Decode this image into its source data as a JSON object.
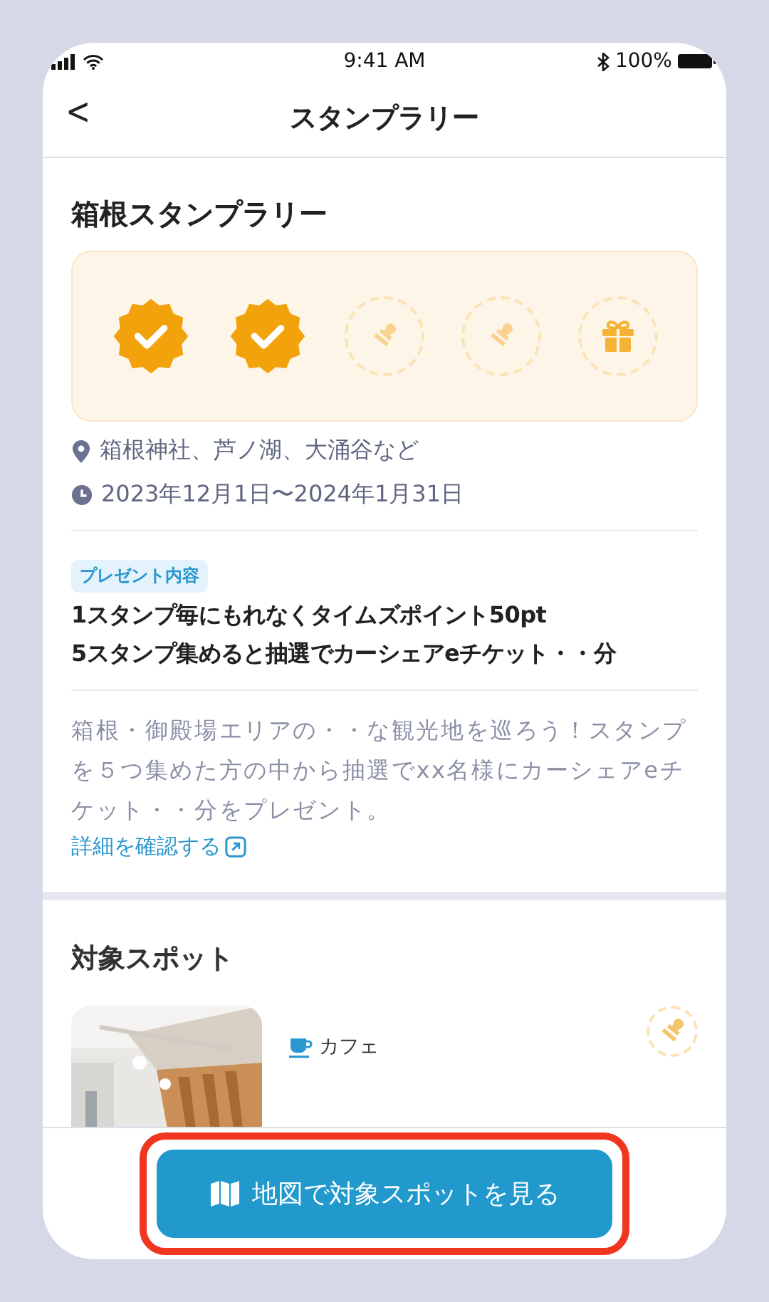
{
  "status_bar": {
    "time": "9:41 AM",
    "battery": "100%"
  },
  "nav": {
    "back": "<",
    "title": "スタンプラリー"
  },
  "rally": {
    "title": "箱根スタンプラリー",
    "stamps": [
      {
        "kind": "stamp",
        "collected": true
      },
      {
        "kind": "stamp",
        "collected": true
      },
      {
        "kind": "stamp",
        "collected": false
      },
      {
        "kind": "stamp",
        "collected": false
      },
      {
        "kind": "gift"
      }
    ],
    "location": "箱根神社、芦ノ湖、大涌谷など",
    "period": "2023年12月1日〜2024年1月31日",
    "present_tag": "プレゼント内容",
    "present_lines": [
      "1スタンプ毎にもれなくタイムズポイント50pt",
      "5スタンプ集めると抽選でカーシェアeチケット・・分"
    ],
    "description": "箱根・御殿場エリアの・・な観光地を巡ろう！スタンプを５つ集めた方の中から抽選でxx名様にカーシェアeチケット・・分をプレゼント。",
    "detail_link": "詳細を確認する"
  },
  "spots": {
    "title": "対象スポット",
    "items": [
      {
        "kind": "picture",
        "category": "カフェ",
        "stamp_collected": false
      }
    ]
  },
  "bottom_button": {
    "label": "地図で対象スポットを見る",
    "highlighted": true
  }
}
